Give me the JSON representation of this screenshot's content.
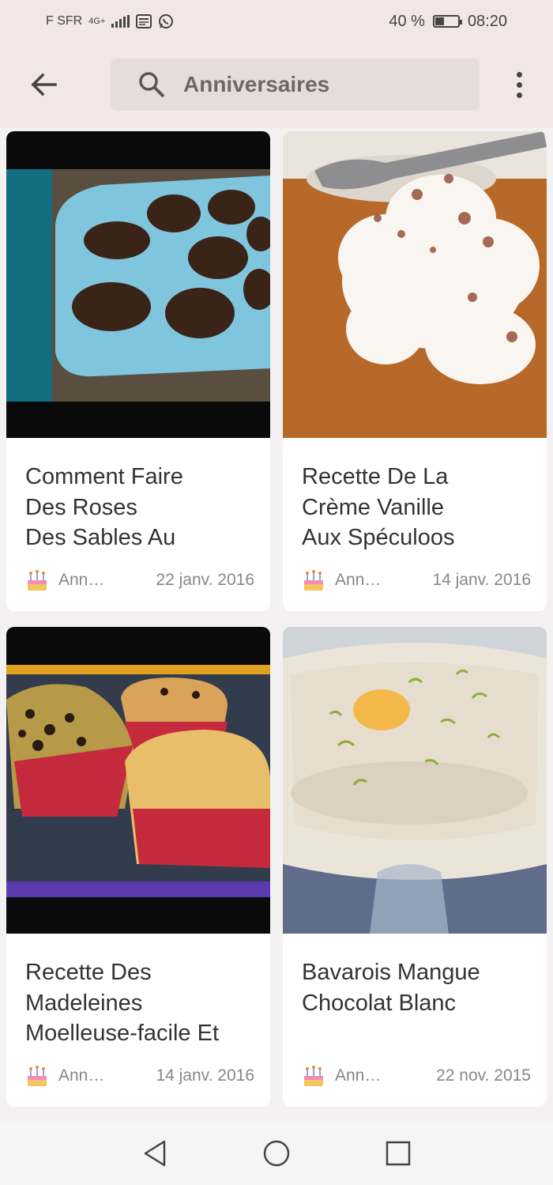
{
  "status_bar": {
    "carrier": "F SFR",
    "network": "4G+",
    "battery_percent": "40 %",
    "battery_level": 0.4,
    "time": "08:20"
  },
  "app_bar": {
    "search_text": "Anniversaires",
    "icons": {
      "back": "arrow-left-icon",
      "search": "search-icon",
      "menu": "more-vertical-icon"
    }
  },
  "cards": [
    {
      "title_lines": [
        "Comment Faire",
        "Des Roses",
        "Des Sables Au"
      ],
      "author": "Ann…",
      "date": "22 janv. 2016",
      "image": "chocolate roses cookies on blue plate"
    },
    {
      "title_lines": [
        "Recette De La",
        "Crème Vanille",
        "Aux Spéculoos"
      ],
      "author": "Ann…",
      "date": "14 janv. 2016",
      "image": "whipped cream on speculoos crumbs"
    },
    {
      "title_lines": [
        "Recette Des",
        "Madeleines",
        "Moelleuse-facile Et"
      ],
      "author": "Ann…",
      "date": "14 janv. 2016",
      "image": "muffins in paper cases"
    },
    {
      "title_lines": [
        "Bavarois Mangue",
        "Chocolat Blanc"
      ],
      "author": "Ann…",
      "date": "22 nov. 2015",
      "image": "mango bavarois in glass cup"
    }
  ],
  "nav_bar": {
    "icons": [
      "back-triangle-icon",
      "home-circle-icon",
      "recents-square-icon"
    ]
  },
  "colors": {
    "app_bar_bg": "#f3e6e6",
    "search_bg": "#e7dcdc",
    "card_bg": "#ffffff",
    "page_bg": "#f3f1f1"
  }
}
